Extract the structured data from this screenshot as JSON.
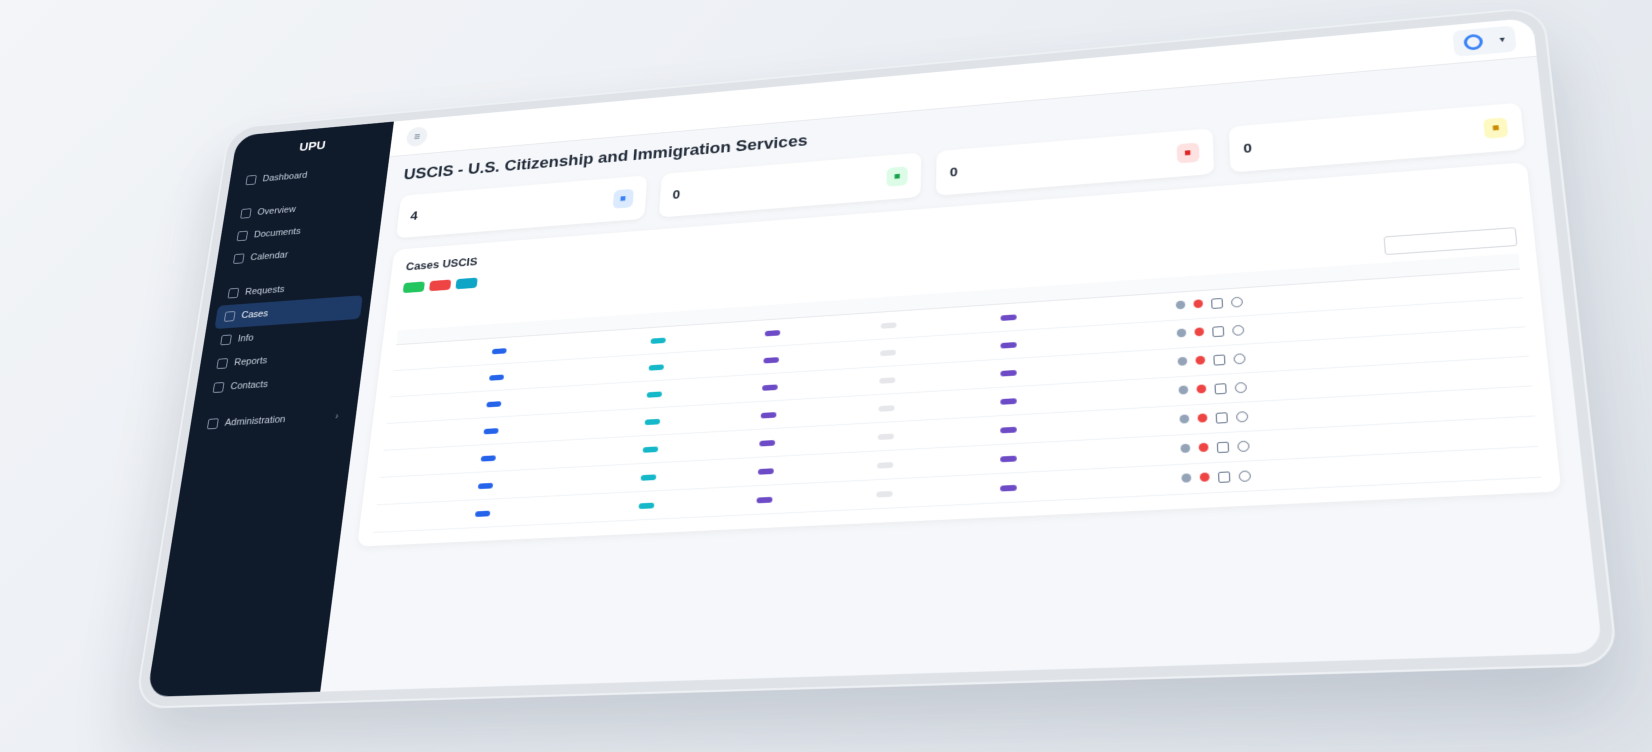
{
  "brand": "UPU",
  "sidebar": {
    "sections": [
      {
        "title": "",
        "items": [
          {
            "label": "Dashboard",
            "active": false
          }
        ]
      },
      {
        "title": "",
        "items": [
          {
            "label": "Overview",
            "active": false
          },
          {
            "label": "Documents",
            "active": false
          },
          {
            "label": "Calendar",
            "active": false
          }
        ]
      },
      {
        "title": "",
        "items": [
          {
            "label": "Requests",
            "active": false
          },
          {
            "label": "Cases",
            "active": true
          },
          {
            "label": "Info",
            "active": false
          },
          {
            "label": "Reports",
            "active": false
          },
          {
            "label": "Contacts",
            "active": false
          }
        ]
      },
      {
        "title": "",
        "items": [
          {
            "label": "Administration",
            "active": false,
            "has_children": true
          }
        ]
      }
    ]
  },
  "topbar": {
    "menu_icon": "menu-icon",
    "link1": "",
    "link2": "",
    "user_name": ""
  },
  "page": {
    "title": "USCIS - U.S. Citizenship and Immigration Services",
    "breadcrumb": ""
  },
  "stats": [
    {
      "label": "",
      "value": "4",
      "icon": "chart-icon",
      "color": "#3b82f6",
      "bg": "#dbeafe"
    },
    {
      "label": "",
      "value": "0",
      "icon": "check-icon",
      "color": "#16a34a",
      "bg": "#dcfce7"
    },
    {
      "label": "",
      "value": "0",
      "icon": "alert-icon",
      "color": "#dc2626",
      "bg": "#fee2e2"
    },
    {
      "label": "",
      "value": "0",
      "icon": "clock-icon",
      "color": "#ca8a04",
      "bg": "#fef9c3"
    }
  ],
  "card": {
    "title": "Cases USCIS",
    "subtitle": "",
    "buttons": [
      {
        "label": "",
        "color": "green"
      },
      {
        "label": "",
        "color": "red"
      },
      {
        "label": "",
        "color": "teal"
      }
    ],
    "search_label": ""
  },
  "table": {
    "headers": [
      "",
      "",
      "",
      "",
      "",
      "",
      "",
      "",
      "",
      ""
    ],
    "rows": [
      {
        "receipt": "",
        "name": "",
        "form": "",
        "status": "",
        "b1": "",
        "b2": "",
        "b3": "",
        "date": ""
      },
      {
        "receipt": "",
        "name": "",
        "form": "",
        "status": "",
        "b1": "",
        "b2": "",
        "b3": "",
        "date": ""
      },
      {
        "receipt": "",
        "name": "",
        "form": "",
        "status": "",
        "b1": "",
        "b2": "",
        "b3": "",
        "date": ""
      },
      {
        "receipt": "",
        "name": "",
        "form": "",
        "status": "",
        "b1": "",
        "b2": "",
        "b3": "",
        "date": ""
      },
      {
        "receipt": "",
        "name": "",
        "form": "",
        "status": "",
        "b1": "",
        "b2": "",
        "b3": "",
        "date": ""
      },
      {
        "receipt": "",
        "name": "",
        "form": "",
        "status": "",
        "b1": "",
        "b2": "",
        "b3": "",
        "date": ""
      },
      {
        "receipt": "",
        "name": "",
        "form": "",
        "status": "",
        "b1": "",
        "b2": "",
        "b3": "",
        "date": ""
      }
    ]
  },
  "colors": {
    "sidebar": "#0f1a2b",
    "accent": "#2563eb"
  }
}
